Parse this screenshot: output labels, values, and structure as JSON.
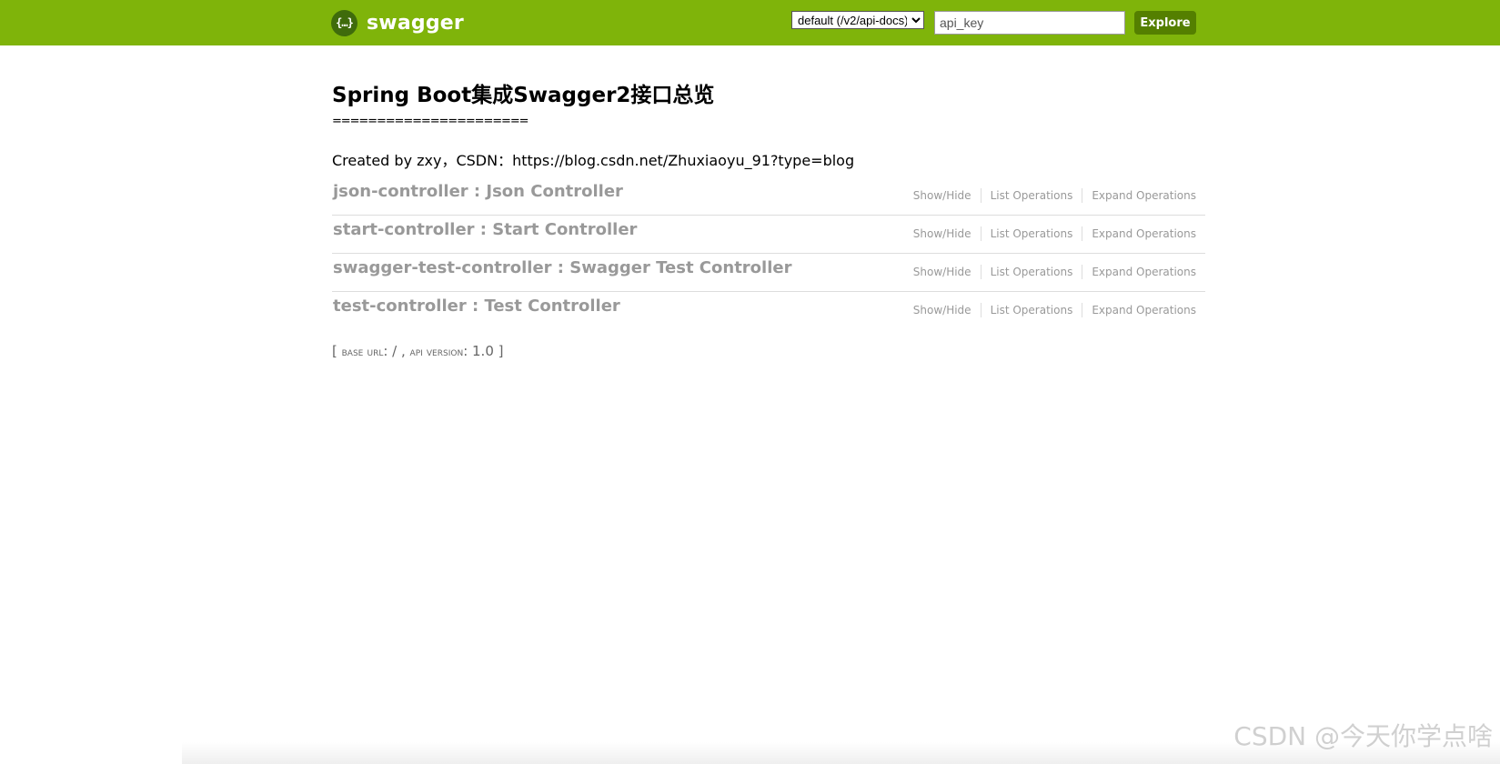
{
  "header": {
    "logo_icon": "{…}",
    "logo_text": "swagger",
    "spec_select": {
      "selected": "default (/v2/api-docs)",
      "options": [
        "default (/v2/api-docs)"
      ]
    },
    "api_key_placeholder": "api_key",
    "explore_label": "Explore",
    "bg_color": "#7fb40a",
    "button_color": "#547f00"
  },
  "info": {
    "title": "Spring Boot集成Swagger2接口总览",
    "divider": "======================",
    "description": "Created by zxy，CSDN：https://blog.csdn.net/Zhuxiaoyu_91?type=blog"
  },
  "resources": [
    {
      "heading": "json-controller : Json Controller",
      "show_hide": "Show/Hide",
      "list_ops": "List Operations",
      "expand_ops": "Expand Operations"
    },
    {
      "heading": "start-controller : Start Controller",
      "show_hide": "Show/Hide",
      "list_ops": "List Operations",
      "expand_ops": "Expand Operations"
    },
    {
      "heading": "swagger-test-controller : Swagger Test Controller",
      "show_hide": "Show/Hide",
      "list_ops": "List Operations",
      "expand_ops": "Expand Operations"
    },
    {
      "heading": "test-controller : Test Controller",
      "show_hide": "Show/Hide",
      "list_ops": "List Operations",
      "expand_ops": "Expand Operations"
    }
  ],
  "footer": {
    "open_bracket": "[ ",
    "base_url_label": "base url",
    "base_url_value": ": / , ",
    "api_version_label": "api version",
    "api_version_value": ": 1.0 ",
    "close_bracket": "]"
  },
  "watermark": "CSDN @今天你学点啥"
}
